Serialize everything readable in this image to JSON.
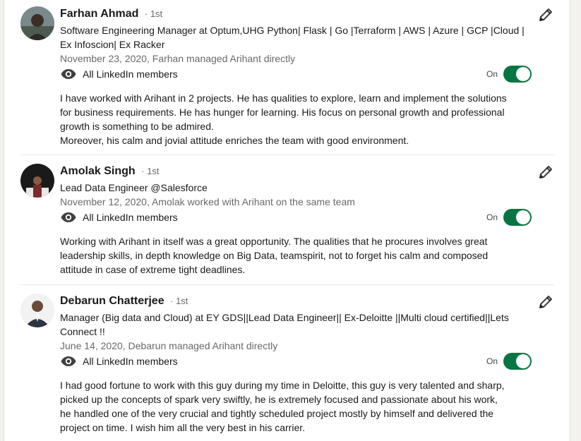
{
  "recommendations": [
    {
      "name": "Farhan Ahmad",
      "degree": "· 1st",
      "headline": "Software Engineering Manager at Optum,UHG Python| Flask | Go |Terraform | AWS | Azure | GCP |Cloud | Ex Infoscion| Ex Racker",
      "meta": "November 23, 2020, Farhan managed Arihant directly",
      "visibility": "All LinkedIn members",
      "toggle_state": "On",
      "text_lines": [
        "I have worked with Arihant in 2 projects. He has qualities to explore, learn and implement the solutions",
        "for business requirements. He has hunger for learning. His focus on personal growth and professional",
        "growth is something to be admired.",
        "Moreover, his calm and jovial attitude enriches the team with good environment."
      ]
    },
    {
      "name": "Amolak Singh",
      "degree": "· 1st",
      "headline": "Lead Data Engineer @Salesforce",
      "meta": "November 12, 2020, Amolak worked with Arihant on the same team",
      "visibility": "All LinkedIn members",
      "toggle_state": "On",
      "text_lines": [
        "Working with Arihant in itself was a great opportunity. The qualities that he procures involves great",
        "leadership skills, in depth knowledge on Big Data, teamspirit, not to forget his calm and composed",
        "attitude in case of extreme tight deadlines."
      ]
    },
    {
      "name": "Debarun Chatterjee",
      "degree": "· 1st",
      "headline": "Manager (Big data and Cloud) at EY GDS||Lead Data Engineer|| Ex-Deloitte ||Multi cloud certified||Lets Connect !!",
      "meta": "June 14, 2020, Debarun managed Arihant directly",
      "visibility": "All LinkedIn members",
      "toggle_state": "On",
      "text_lines": [
        "I had good fortune to work with this guy during my time in Deloitte, this guy is very talented and sharp,",
        "picked up the concepts of spark very swiftly, he is extremely focused and passionate about his work,",
        "he handled one of the very crucial and tightly scheduled project mostly by himself and delivered the",
        "project on time. I wish him all the very best in his carrier."
      ]
    }
  ],
  "colors": {
    "toggle_on": "#057642",
    "meta_text": "rgba(0,0,0,0.6)"
  },
  "icons": [
    "eye-icon",
    "pencil-icon"
  ]
}
